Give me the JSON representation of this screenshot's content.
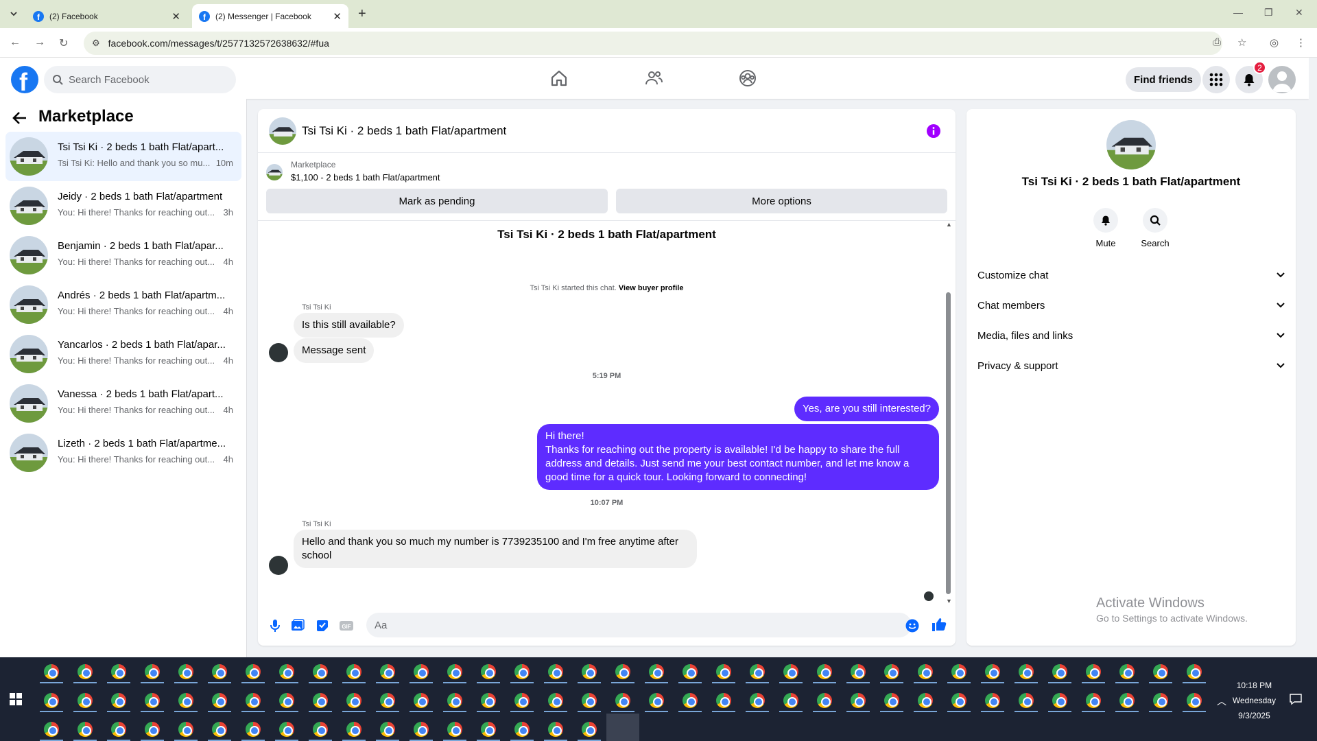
{
  "browser": {
    "tabs": [
      {
        "title": "(2) Facebook",
        "active": false
      },
      {
        "title": "(2) Messenger | Facebook",
        "active": true
      }
    ],
    "url": "facebook.com/messages/t/2577132572638632/#fua"
  },
  "header": {
    "logo": "f",
    "search_placeholder": "Search Facebook",
    "find_friends": "Find friends",
    "notification_count": "2"
  },
  "left": {
    "title": "Marketplace",
    "conversations": [
      {
        "name": "Tsi Tsi Ki · 2 beds 1 bath Flat/apart...",
        "preview": "Tsi Tsi Ki: Hello and thank you so mu...",
        "time": "10m",
        "active": true
      },
      {
        "name": "Jeidy · 2 beds 1 bath Flat/apartment",
        "preview": "You: Hi there! Thanks for reaching out...",
        "time": "3h",
        "active": false
      },
      {
        "name": "Benjamin · 2 beds 1 bath Flat/apar...",
        "preview": "You: Hi there! Thanks for reaching out...",
        "time": "4h",
        "active": false
      },
      {
        "name": "Andrés · 2 beds 1 bath Flat/apartm...",
        "preview": "You: Hi there! Thanks for reaching out...",
        "time": "4h",
        "active": false
      },
      {
        "name": "Yancarlos · 2 beds 1 bath Flat/apar...",
        "preview": "You: Hi there! Thanks for reaching out...",
        "time": "4h",
        "active": false
      },
      {
        "name": "Vanessa · 2 beds 1 bath Flat/apart...",
        "preview": "You: Hi there! Thanks for reaching out...",
        "time": "4h",
        "active": false
      },
      {
        "name": "Lizeth · 2 beds 1 bath Flat/apartme...",
        "preview": "You: Hi there! Thanks for reaching out...",
        "time": "4h",
        "active": false
      }
    ]
  },
  "chat": {
    "title": "Tsi Tsi Ki · 2 beds 1 bath Flat/apartment",
    "listing_label": "Marketplace",
    "listing_detail": "$1,100 - 2 beds 1 bath Flat/apartment",
    "mark_pending": "Mark as pending",
    "more_options": "More options",
    "conversation_title": "Tsi Tsi Ki · 2 beds 1 bath Flat/apartment",
    "system_text": "Tsi Tsi Ki started this chat.",
    "system_link": "View buyer profile",
    "sender1": "Tsi Tsi Ki",
    "msg_in_1": "Is this still available?",
    "msg_in_2": "Message sent",
    "time1": "5:19 PM",
    "msg_out_1": "Yes, are you still interested?",
    "msg_out_2_l1": "Hi there!",
    "msg_out_2_l2": "Thanks for reaching out the property is available! I'd be happy to share the full address and details. Just send me your best contact number, and let me know a good time for a quick tour. Looking forward to connecting!",
    "time2": "10:07 PM",
    "sender2": "Tsi Tsi Ki",
    "msg_in_3": "Hello and thank you so much my number is 7739235100 and I'm free anytime after school",
    "composer_placeholder": "Aa"
  },
  "right": {
    "name": "Tsi Tsi Ki · 2 beds 1 bath Flat/apartment",
    "mute": "Mute",
    "search": "Search",
    "sections": [
      "Customize chat",
      "Chat members",
      "Media, files and links",
      "Privacy & support"
    ]
  },
  "watermark": {
    "line1": "Activate Windows",
    "line2": "Go to Settings to activate Windows."
  },
  "taskbar": {
    "time": "10:18 PM",
    "day": "Wednesday",
    "date": "9/3/2025"
  },
  "colors": {
    "fb_blue": "#1877f2",
    "outgoing_bubble": "#5e2cff",
    "info_purple": "#a100ff"
  }
}
